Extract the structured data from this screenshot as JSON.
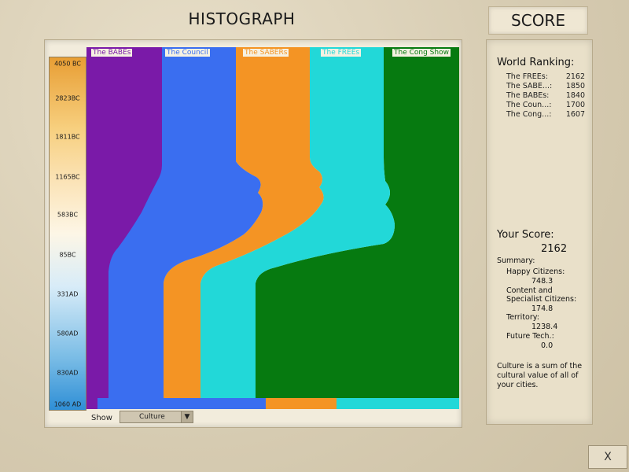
{
  "title": "HISTOGRAPH",
  "score_tab": "SCORE",
  "timescale": [
    "4050 BC",
    "2823BC",
    "1811BC",
    "1165BC",
    "583BC",
    "85BC",
    "331AD",
    "580AD",
    "830AD",
    "1060 AD"
  ],
  "civs": [
    {
      "name": "The BABEs",
      "color": "#7a1aa8"
    },
    {
      "name": "The Council",
      "color": "#3a6ef0"
    },
    {
      "name": "The SABERs",
      "color": "#f49424"
    },
    {
      "name": "The FREEs",
      "color": "#22d8d8"
    },
    {
      "name": "The Cong Show",
      "color": "#067a10"
    }
  ],
  "show_label": "Show",
  "show_value": "Culture",
  "world_ranking": {
    "heading": "World Ranking:",
    "rows": [
      {
        "name": "The FREEs:",
        "score": "2162"
      },
      {
        "name": "The SABE...:",
        "score": "1850"
      },
      {
        "name": "The BABEs:",
        "score": "1840"
      },
      {
        "name": "The Coun...:",
        "score": "1700"
      },
      {
        "name": "The Cong...:",
        "score": "1607"
      }
    ]
  },
  "your_score": {
    "heading": "Your Score:",
    "value": "2162",
    "summary_label": "Summary:",
    "happy_label": "Happy Citizens:",
    "happy_value": "748.3",
    "content_label_1": "Content and",
    "content_label_2": "Specialist Citizens:",
    "content_value": "174.8",
    "territory_label": "Territory:",
    "territory_value": "1238.4",
    "future_label": "Future Tech.:",
    "future_value": "0.0"
  },
  "culture_note": [
    "Culture is a sum of the",
    "cultural value of all of",
    "your cities."
  ],
  "close_label": "X"
}
